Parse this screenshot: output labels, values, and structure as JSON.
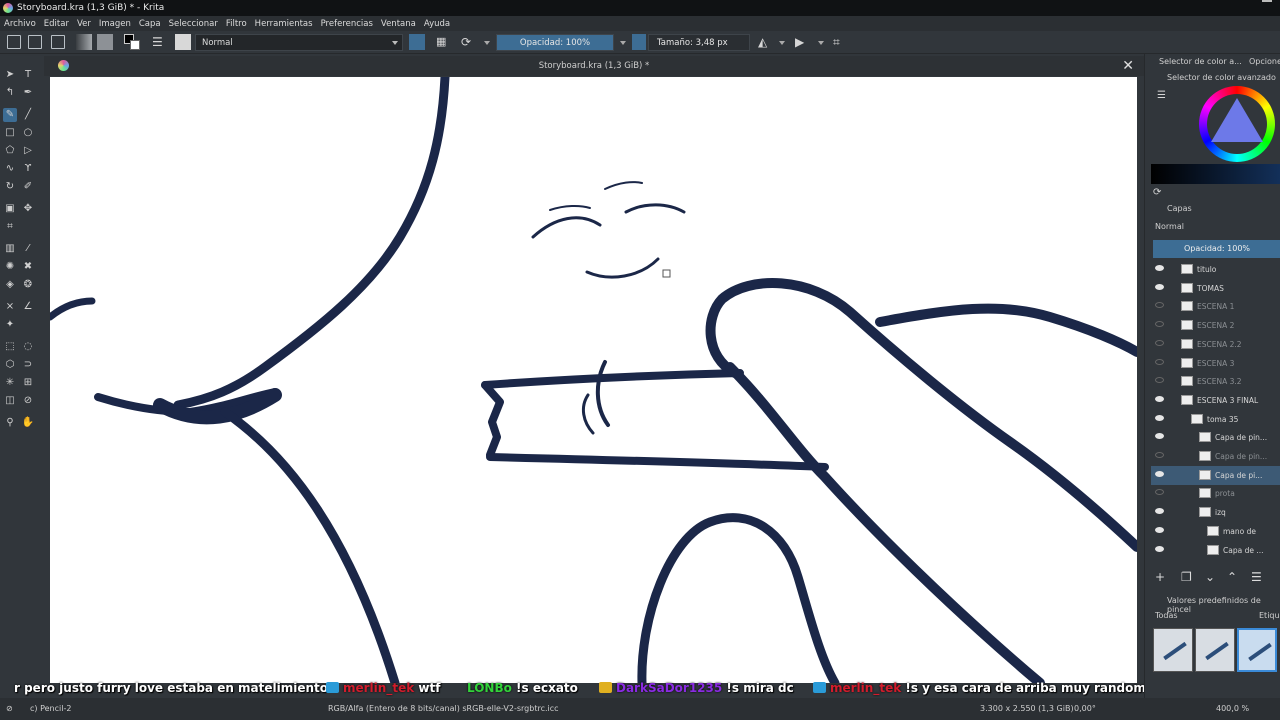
{
  "window": {
    "title": "Storyboard.kra (1,3 GiB) * - Krita"
  },
  "menu": [
    "Archivo",
    "Editar",
    "Ver",
    "Imagen",
    "Capa",
    "Seleccionar",
    "Filtro",
    "Herramientas",
    "Preferencias",
    "Ventana",
    "Ayuda"
  ],
  "toolbar": {
    "blend_mode": "Normal",
    "opacity_label": "Opacidad: 100%",
    "opacity_value": 1.0,
    "size_label": "Tamaño: 3,48 px"
  },
  "document": {
    "tab_title": "Storyboard.kra (1,3 GiB) *",
    "close_glyph": "✕"
  },
  "dock": {
    "tab_color_selector": "Selector de color a...",
    "tab_options": "Opcione",
    "advanced_color_selector": "Selector de color avanzado",
    "layers_title": "Capas",
    "layer_blend_mode": "Normal",
    "layer_opacity_label": "Opacidad:  100%",
    "layers": [
      {
        "name": "titulo",
        "visible": true
      },
      {
        "name": "TOMAS",
        "visible": true
      },
      {
        "name": "ESCENA 1",
        "visible": false
      },
      {
        "name": "ESCENA 2",
        "visible": false
      },
      {
        "name": "ESCENA 2.2",
        "visible": false
      },
      {
        "name": "ESCENA 3",
        "visible": false
      },
      {
        "name": "ESCENA 3.2",
        "visible": false
      },
      {
        "name": "ESCENA 3 FINAL",
        "visible": true
      },
      {
        "name": "toma 35",
        "visible": true
      },
      {
        "name": "Capa de pin...",
        "visible": true
      },
      {
        "name": "Capa de pin...",
        "visible": false
      },
      {
        "name": "Capa de pi...",
        "visible": true,
        "selected": true
      },
      {
        "name": "prota",
        "visible": false
      },
      {
        "name": "izq",
        "visible": true
      },
      {
        "name": "mano de",
        "visible": true
      },
      {
        "name": "Capa de ...",
        "visible": true
      }
    ],
    "brush_presets_title": "Valores predefinidos de pincel",
    "brush_filter": "Todas",
    "brush_tag": "Etique"
  },
  "chat": [
    {
      "user": "",
      "message": "r pero justo furry love estaba en matelimiento",
      "user_color": "#ffffff"
    },
    {
      "user": "merlin_tek",
      "message": "wtf",
      "user_color": "#d21c2c"
    },
    {
      "user": "LONBo",
      "message": "!s ecxato",
      "user_color": "#32d23a"
    },
    {
      "user": "DarkSaDor1235",
      "message": "!s mira dc",
      "user_color": "#8a2be2"
    },
    {
      "user": "merlin_tek",
      "message": "!s y esa cara de arriba muy random",
      "user_color": "#d21c2c"
    },
    {
      "user": "merlin_tek",
      "message": "",
      "user_color": "#d21c2c"
    }
  ],
  "status": {
    "brush_name": "c) Pencil-2",
    "color_space": "RGB/Alfa (Entero de 8 bits/canal)  sRGB-elle-V2-srgbtrc.icc",
    "image_size": "3.300 x 2.550 (1,3 GiB)",
    "rotation": "0,00°",
    "zoom": "400,0 %"
  },
  "colors": {
    "accent": "#3d6d94",
    "ink": "#1b2748"
  }
}
